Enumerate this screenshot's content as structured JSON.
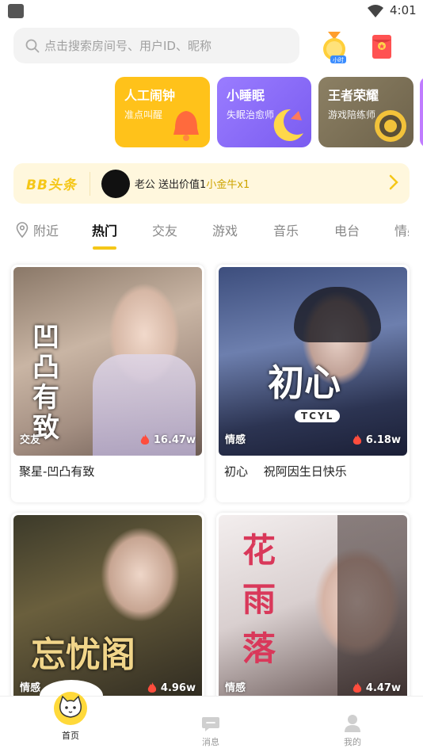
{
  "status_bar": {
    "time": "4:01"
  },
  "search": {
    "placeholder": "点击搜索房间号、用户ID、昵称"
  },
  "top_icons": {
    "medal_label": "小时"
  },
  "promos": [
    {
      "title": "人工闹钟",
      "subtitle": "准点叫醒",
      "color": "#ffc21a"
    },
    {
      "title": "小睡眠",
      "subtitle": "失眠治愈师",
      "color": "#8b6cf3"
    },
    {
      "title": "王者荣耀",
      "subtitle": "游戏陪练师",
      "color": "#7d7258"
    }
  ],
  "headline": {
    "logo": "BB头条",
    "message": "老公 送出价值1",
    "gift": "小金牛x1"
  },
  "tabs": [
    {
      "label": "附近"
    },
    {
      "label": "热门"
    },
    {
      "label": "交友"
    },
    {
      "label": "游戏"
    },
    {
      "label": "音乐"
    },
    {
      "label": "电台"
    },
    {
      "label": "情感"
    }
  ],
  "rooms": [
    {
      "title": "聚星-凹凸有致",
      "tag": "交友",
      "hot": "16.47w",
      "overlay": "凹凸有致"
    },
    {
      "title": "初心 　祝阿因生日快乐",
      "tag": "情感",
      "hot": "6.18w",
      "overlay": "初心",
      "overlay_sub": "TCYL"
    },
    {
      "title": "",
      "tag": "情感",
      "hot": "4.96w",
      "overlay": "忘忧阁"
    },
    {
      "title": "",
      "tag": "情感",
      "hot": "4.47w",
      "overlay": "花雨落"
    }
  ],
  "bottom_nav": [
    {
      "label": "首页"
    },
    {
      "label": "消息"
    },
    {
      "label": "我的"
    }
  ],
  "colors": {
    "accent": "#f5c718",
    "hot": "#ff4d3d"
  }
}
